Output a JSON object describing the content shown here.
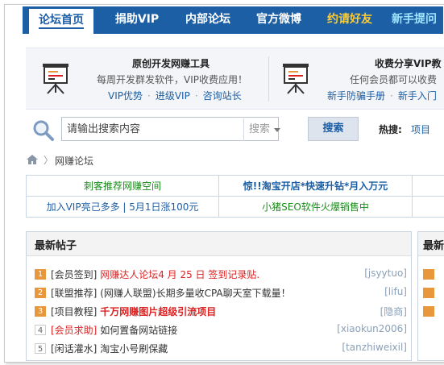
{
  "nav": {
    "items": [
      {
        "label": "论坛首页"
      },
      {
        "label": "捐助VIP"
      },
      {
        "label": "内部论坛"
      },
      {
        "label": "官方微博"
      },
      {
        "label": "约请好友"
      },
      {
        "label": "新手提问"
      }
    ]
  },
  "promo": {
    "left": {
      "title": "原创开发网赚工具",
      "subtitle": "每周开发群发软件，VIP收费应用！",
      "links": [
        "VIP优势",
        "进级VIP",
        "咨询站长"
      ]
    },
    "right": {
      "title": "收费分享VIP教",
      "subtitle": "任何会员都可以收费",
      "links": [
        "新手防骗手册",
        "新手入门"
      ]
    }
  },
  "search": {
    "placeholder": "请输出搜索内容",
    "scope": "搜索",
    "button": "搜索",
    "hot_label": "热搜:",
    "hot_items": [
      "项目"
    ]
  },
  "breadcrumb": {
    "current": "网赚论坛"
  },
  "ads": [
    {
      "text": "刺客推荐网赚空间"
    },
    {
      "text": "惊!!淘宝开店*快速升钻*月入万元"
    },
    {
      "text": "加入VIP亮己多多 | 5月1日涨100元"
    },
    {
      "text": "小猪SEO软件火爆销售中"
    }
  ],
  "latest": {
    "title": "最新帖子",
    "posts": [
      {
        "num": "1",
        "tag": "[会员签到]",
        "title": "网赚达人论坛4 月 25 日 签到记录贴.",
        "author": "[jsyytuo]"
      },
      {
        "num": "2",
        "tag": "[联盟推荐]",
        "title": "(网赚人联盟)长期多量收CPA聊天室下载量！",
        "author": "[lifu]"
      },
      {
        "num": "3",
        "tag": "[项目教程]",
        "title": "千万网赚图片超级引流项目",
        "author": "[隐商]"
      },
      {
        "num": "4",
        "tag": "[会员求助]",
        "title": "如何置备网站链接",
        "author": "[xiaokun2006]"
      },
      {
        "num": "5",
        "tag": "[闲话灌水]",
        "title": "淘宝小号刷保藏",
        "author": "[tanzhiweixil]"
      }
    ]
  },
  "side_panel": {
    "title": "最新"
  },
  "colors": {
    "nav_bg": "#1d5fa5",
    "accent_orange": "#e8973a",
    "green_text": "#1a8c1a",
    "red_text": "#dd2222"
  }
}
